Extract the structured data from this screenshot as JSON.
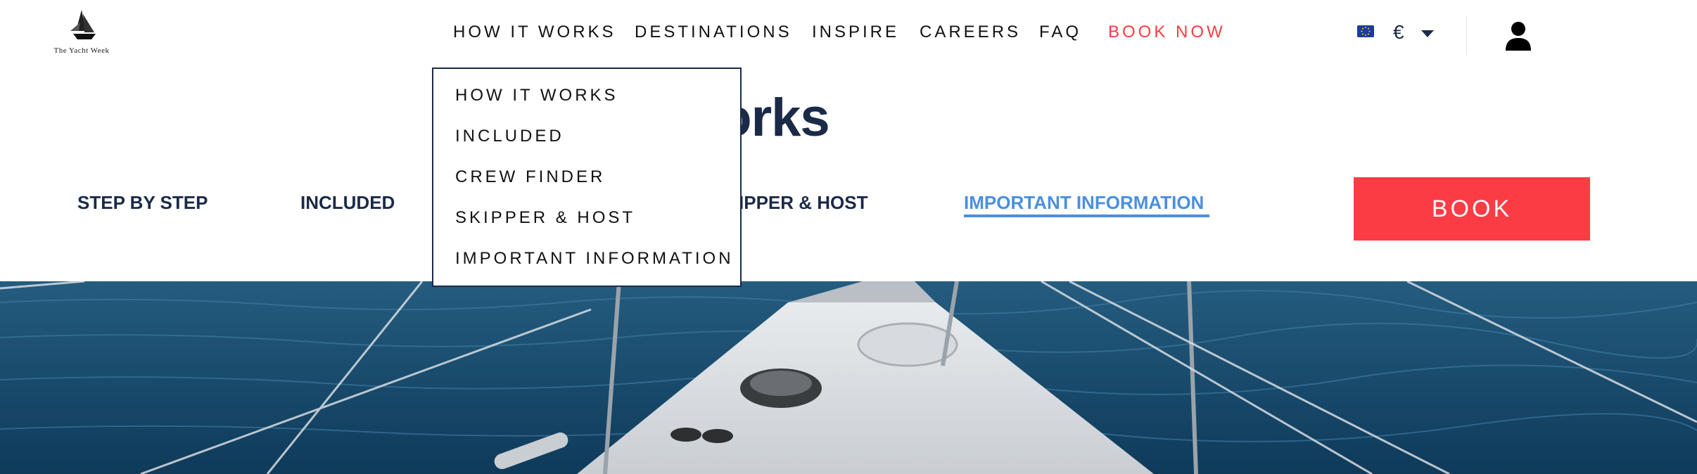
{
  "brand": {
    "logo_text": "The Yacht Week"
  },
  "nav": {
    "items": [
      {
        "label": "HOW IT WORKS"
      },
      {
        "label": "DESTINATIONS"
      },
      {
        "label": "INSPIRE"
      },
      {
        "label": "CAREERS"
      },
      {
        "label": "FAQ"
      },
      {
        "label": "BOOK NOW"
      }
    ],
    "book_now_color": "#fb3c45"
  },
  "utility": {
    "flag_icon": "eu-flag-icon",
    "currency": "€",
    "dropdown_icon": "caret-down-icon",
    "user_icon": "user-icon"
  },
  "dropdown": {
    "items": [
      {
        "label": "HOW IT WORKS"
      },
      {
        "label": "INCLUDED"
      },
      {
        "label": "CREW FINDER"
      },
      {
        "label": "SKIPPER & HOST"
      },
      {
        "label": "IMPORTANT INFORMATION"
      }
    ]
  },
  "page": {
    "title_visible": "w it works",
    "subnav": [
      {
        "label": "STEP BY STEP"
      },
      {
        "label": "INCLUDED"
      },
      {
        "label": "IPPER & HOST"
      },
      {
        "label": "IMPORTANT INFORMATION",
        "active": true
      }
    ],
    "book_button": "BOOK",
    "accent_color": "#4a8fdf"
  }
}
